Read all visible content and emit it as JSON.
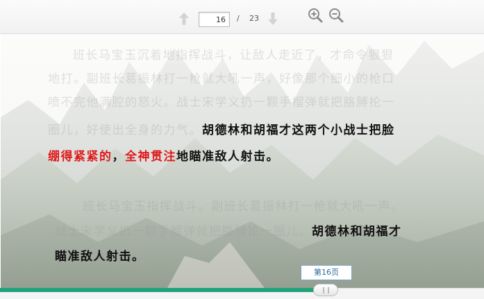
{
  "toolbar": {
    "current_page": "16",
    "separator": "/",
    "total_pages": "23",
    "icons": {
      "prev": "arrow-up-icon",
      "next": "arrow-down-icon",
      "zoom_in": "zoom-in-icon",
      "zoom_out": "zoom-out-icon"
    }
  },
  "content": {
    "paragraph_1": {
      "faded_line_1": "班长马宝玉沉着地指挥战斗，让敌人走近了，才命令狠狠",
      "faded_line_2": "地打。副班长葛振林打一枪就大吼一声，好像那个细小的枪口",
      "faded_line_3": "喷不完他满腔的怒火。战士宋学义扔一颗手榴弹就把胳膊抡一",
      "faded_line_4_a": "圈儿，好使出全身的力气。",
      "highlight_line_4_b": "胡德林和胡福才这两个小战士把脸",
      "red_1": "绷得紧紧的",
      "sep_1": "，",
      "red_2": "全神贯注",
      "highlight_line_5_b": "地瞄准敌人射击。"
    },
    "paragraph_2": {
      "faded_line_1": "班长马宝玉指挥战斗。副班长葛振林打一枪就大吼一声。",
      "faded_line_2_a": "战士宋学义扔一颗手榴弹就把胳膊抡一圈儿。",
      "highlight_line_2_b": "胡德林和胡福才",
      "highlight_line_3": "瞄准敌人射击。"
    }
  },
  "progress": {
    "fraction": 0.652,
    "tooltip": "第16页"
  },
  "colors": {
    "accent_green": "#22a27b",
    "highlight_red": "#e0191a",
    "toolbar_bg": "#f4f4f4"
  }
}
